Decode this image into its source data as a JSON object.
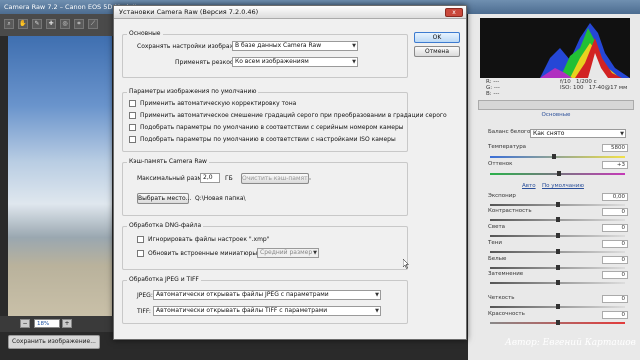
{
  "app": {
    "window_title": "Camera Raw 7.2  –  Canon EOS 5D Mark II",
    "tools": [
      "zoom-icon",
      "hand-icon",
      "eyedropper-icon",
      "color-sampler-icon",
      "target-icon",
      "crop-icon",
      "straighten-icon"
    ],
    "zoom_value": "18%",
    "save_button": "Сохранить изображение..."
  },
  "histogram": {
    "rgb_labels": {
      "r": "R:",
      "g": "G:",
      "b": "B:"
    },
    "r_val": "---",
    "g_val": "---",
    "b_val": "---",
    "aperture": "f/10",
    "shutter": "1/200 с",
    "iso": "ISO: 100",
    "lens": "17-40@17 мм"
  },
  "basic_panel": {
    "title": "Основные",
    "wb_label": "Баланс белого:",
    "wb_value": "Как снято",
    "temp_label": "Температура",
    "temp_value": "5800",
    "tint_label": "Оттенок",
    "tint_value": "+3",
    "auto_link": "Авто",
    "default_link": "По умолчанию",
    "exposure_label": "Экспонир",
    "exposure_value": "0,00",
    "contrast_label": "Контрастность",
    "contrast_value": "0",
    "light_label": "Света",
    "light_value": "0",
    "shadow_label": "Тени",
    "shadow_value": "0",
    "white_label": "Белые",
    "white_value": "0",
    "black_label": "Затемнение",
    "black_value": "0",
    "clarity_label": "Четкость",
    "clarity_value": "0",
    "vib_label": "Красочность",
    "vib_value": "0"
  },
  "dialog": {
    "title": "Установки Camera Raw  (Версия 7.2.0.46)",
    "close_label": "x",
    "ok_label": "OK",
    "cancel_label": "Отмена",
    "general": {
      "legend": "Основные",
      "save_settings_label": "Сохранять настройки изображений:",
      "save_settings_value": "В базе данных Camera Raw",
      "sharpen_label": "Применять резкость:",
      "sharpen_value": "Ко всем изображениям"
    },
    "defaults": {
      "legend": "Параметры изображения по умолчанию",
      "options": [
        "Применить автоматическую корректировку тона",
        "Применить автоматическое смешение градаций серого при преобразовании в градации серого",
        "Подобрать параметры по умолчанию в соответствии с серийным номером камеры",
        "Подобрать параметры по умолчанию в соответствии с настройками ISO камеры"
      ]
    },
    "cache": {
      "legend": "Кэш-память Camera Raw",
      "max_size_label": "Максимальный размер:",
      "max_size_value": "2,0",
      "unit": "ГБ",
      "clear_button": "Очистить кэш-память",
      "select_button": "Выбрать место...",
      "path": "Q:\\Новая папка\\"
    },
    "dng": {
      "legend": "Обработка DNG-файла",
      "ignore_label": "Игнорировать файлы настроек \".xmp\"",
      "update_label": "Обновить встроенные миниатюры JPEG:",
      "size_value": "Средний размер"
    },
    "jpeg_tiff": {
      "legend": "Обработка JPEG и TIFF",
      "jpeg_label": "JPEG:",
      "jpeg_value": "Автоматически открывать файлы JPEG с параметрами",
      "tiff_label": "TIFF:",
      "tiff_value": "Автоматически открывать файлы TIFF с параметрами"
    }
  },
  "signature": "Автор: Евгений Карташов"
}
